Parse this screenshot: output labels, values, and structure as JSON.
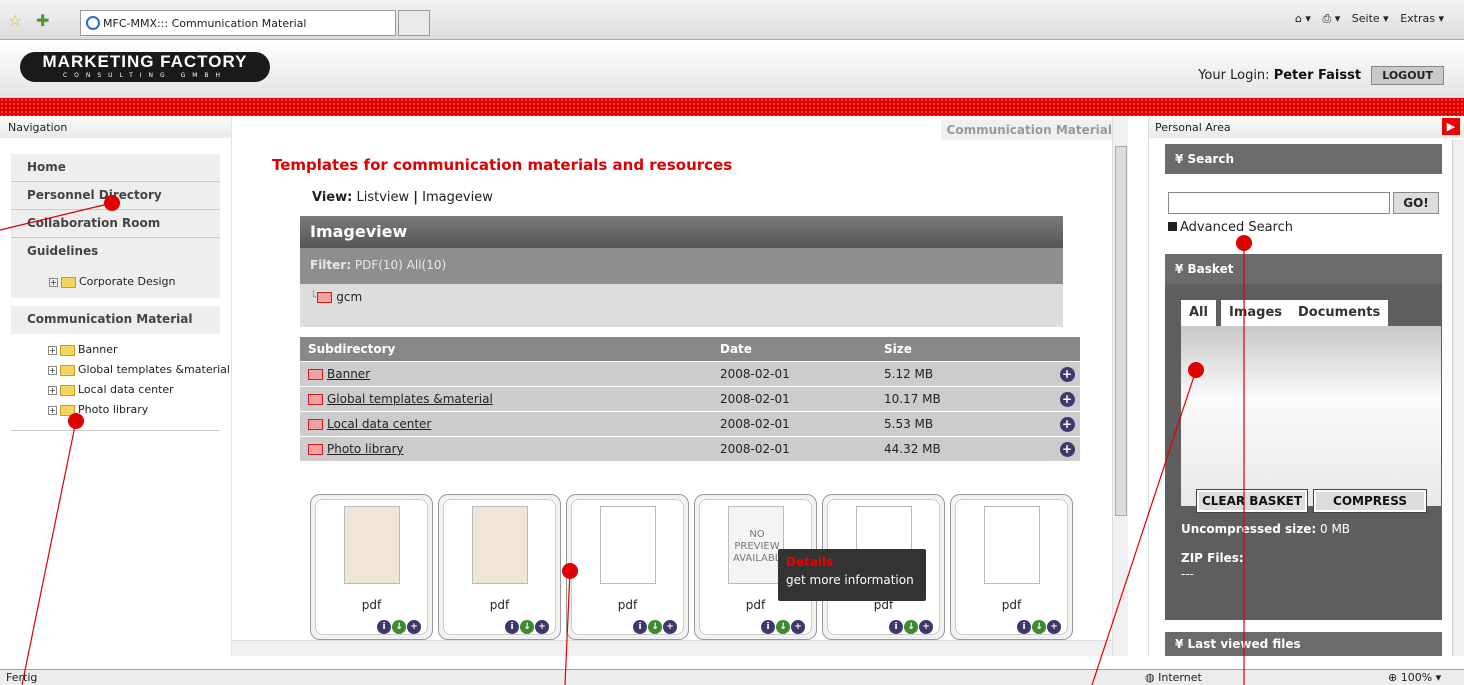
{
  "browser": {
    "tab_title": "MFC-MMX::: Communication Material",
    "tools": [
      "Seite ▾",
      "Extras ▾"
    ]
  },
  "header": {
    "logo_main": "MARKETING FACTORY",
    "logo_sub": "CONSULTING GMBH",
    "login_label": "Your Login:",
    "login_user": "Peter Faisst",
    "logout_label": "LOGOUT"
  },
  "nav": {
    "title": "Navigation",
    "items": [
      "Home",
      "Personnel Directory",
      "Collaboration Room",
      "Guidelines"
    ],
    "guidelines_tree": [
      "Corporate Design"
    ],
    "section": "Communication Material",
    "comm_tree": [
      "Banner",
      "Global templates &material",
      "Local data center",
      "Photo library"
    ]
  },
  "main": {
    "breadcrumb": "Communication Material",
    "title": "Templates for communication materials and resources",
    "view_label": "View:",
    "view_list": "Listview",
    "view_sep": "|",
    "view_image": "Imageview",
    "box_title": "Imageview",
    "filter_label": "Filter:",
    "filter_options": "PDF(10)  All(10)",
    "folder": "gcm",
    "columns": [
      "Subdirectory",
      "Date",
      "Size"
    ],
    "rows": [
      {
        "name": "Banner",
        "date": "2008-02-01",
        "size": "5.12 MB"
      },
      {
        "name": "Global templates &material",
        "date": "2008-02-01",
        "size": "10.17 MB"
      },
      {
        "name": "Local data center",
        "date": "2008-02-01",
        "size": "5.53 MB"
      },
      {
        "name": "Photo library",
        "date": "2008-02-01",
        "size": "44.32 MB"
      }
    ],
    "thumb_label": "pdf",
    "no_preview": "NO PREVIEW AVAILABLE",
    "tooltip_title": "Details",
    "tooltip_text": "get more information"
  },
  "right": {
    "title": "Personal Area",
    "search_title": "Search",
    "go_label": "GO!",
    "advanced": "Advanced Search",
    "basket_title": "Basket",
    "tabs": [
      "All",
      "Images",
      "Documents"
    ],
    "clear": "CLEAR BASKET",
    "compress": "COMPRESS",
    "uncomp_label": "Uncompressed size:",
    "uncomp_value": "0 MB",
    "zip_label": "ZIP Files:",
    "zip_value": "---",
    "last_viewed": "Last viewed files"
  },
  "status": {
    "text": "Fertig",
    "zone": "Internet",
    "zoom": "100%"
  },
  "colors": {
    "accent": "#e00000",
    "panel": "#6b6b6b"
  }
}
